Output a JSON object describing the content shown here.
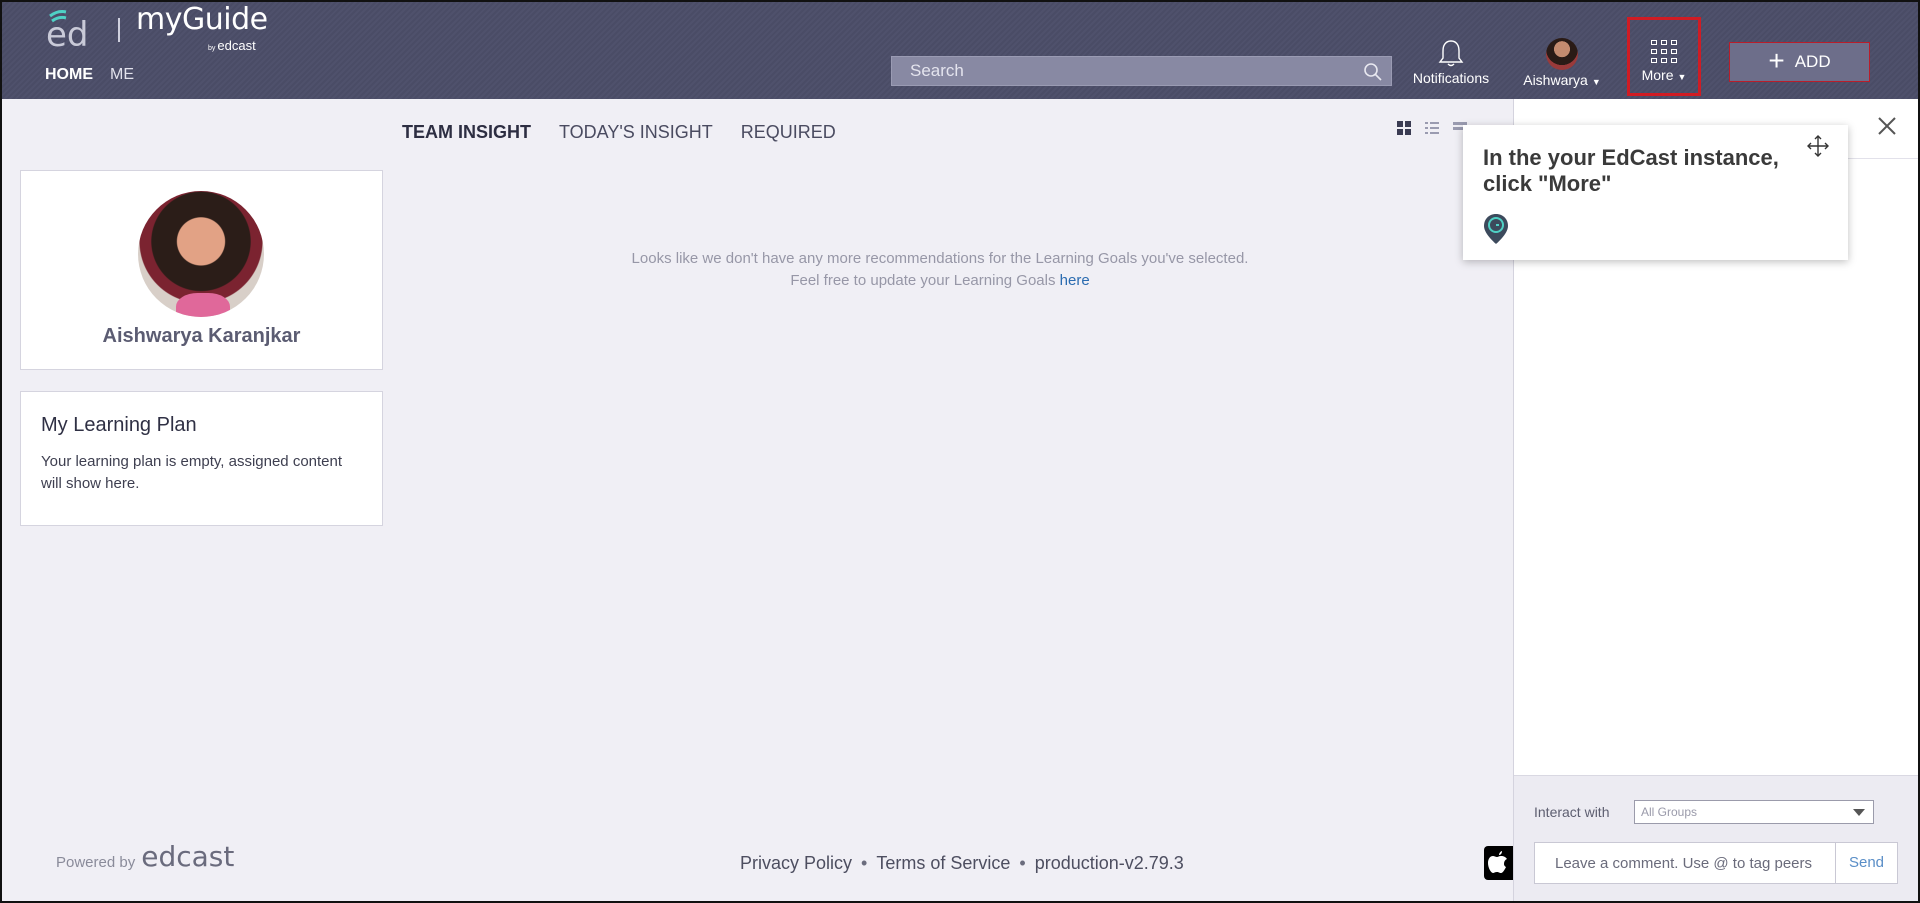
{
  "header": {
    "logo_main": "myGuide",
    "logo_sub_prefix": "by",
    "logo_sub": "edcast",
    "nav": {
      "home": "HOME",
      "me": "ME"
    },
    "search_placeholder": "Search",
    "notifications_label": "Notifications",
    "user_label": "Aishwarya",
    "more_label": "More",
    "add_label": "ADD",
    "highlight_color": "#d01c24"
  },
  "tabs": [
    {
      "label": "TEAM INSIGHT",
      "active": true
    },
    {
      "label": "TODAY'S INSIGHT",
      "active": false
    },
    {
      "label": "REQUIRED",
      "active": false
    }
  ],
  "profile": {
    "name": "Aishwarya Karanjkar"
  },
  "learning_plan": {
    "title": "My Learning Plan",
    "text": "Your learning plan is empty, assigned content will show here."
  },
  "empty_state": {
    "line1": "Looks like we don't have any more recommendations for the Learning Goals you've selected.",
    "line2_prefix": "Feel free to update your Learning Goals",
    "line2_link": "here"
  },
  "footer": {
    "powered_by": "Powered by",
    "brand": "edcast",
    "privacy": "Privacy Policy",
    "terms": "Terms of Service",
    "version": "production-v2.79.3",
    "separator": "•"
  },
  "right_panel": {
    "interact_label": "Interact with",
    "groups_value": "All Groups",
    "comment_placeholder": "Leave a comment. Use @ to tag peers",
    "send_label": "Send"
  },
  "tooltip": {
    "text": "In the your EdCast instance, click \"More\""
  }
}
